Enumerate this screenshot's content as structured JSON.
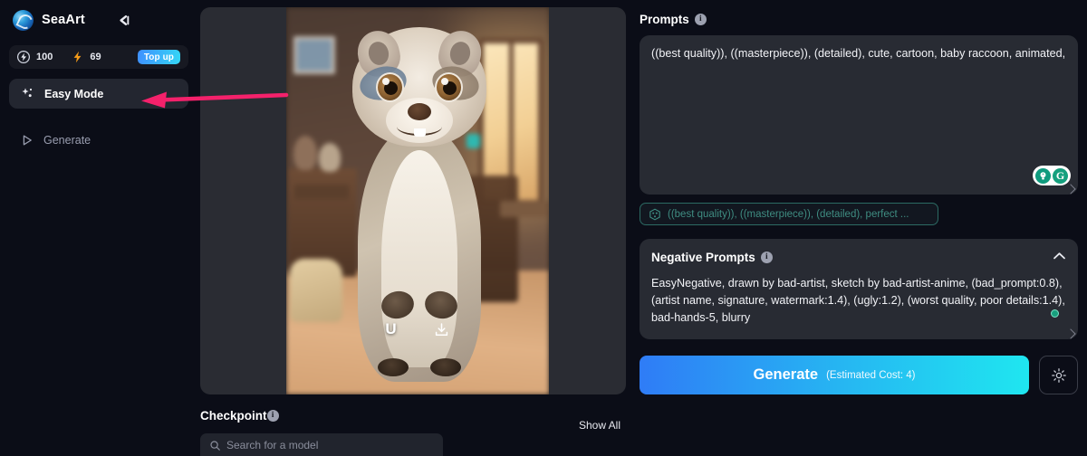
{
  "app": {
    "brand": "SeaArt",
    "collapse_icon": "collapse-sidebar-icon"
  },
  "sidebar": {
    "credits": {
      "diamond_icon": "credit-bolt-icon",
      "diamond_value": "100",
      "bolt_icon": "energy-bolt-icon",
      "bolt_value": "69",
      "topup_label": "Top up"
    },
    "items": [
      {
        "label": "Easy Mode",
        "icon": "sparkles-icon",
        "active": true
      },
      {
        "label": "Generate",
        "icon": "play-icon",
        "active": false
      }
    ]
  },
  "preview": {
    "upscale_label": "U",
    "download_icon": "download-icon",
    "image_alt": "cute cartoon baby raccoon standing in a warmly lit room"
  },
  "checkpoint": {
    "label": "Checkpoint",
    "show_all": "Show All",
    "search_placeholder": "Search for a model",
    "search_icon": "search-icon"
  },
  "prompts": {
    "title": "Prompts",
    "value": "((best quality)), ((masterpiece)), (detailed), cute, cartoon, baby raccoon, animated,",
    "bulb_icon": "lightbulb-icon",
    "grammar_icon": "grammarly-icon",
    "tag": {
      "icon": "dice-icon",
      "label": "((best quality)), ((masterpiece)), (detailed), perfect ..."
    }
  },
  "negative_prompts": {
    "title": "Negative Prompts",
    "collapse_icon": "chevron-up-icon",
    "value": "EasyNegative, drawn by bad-artist, sketch by bad-artist-anime, (bad_prompt:0.8), (artist name, signature, watermark:1.4), (ugly:1.2), (worst quality, poor details:1.4), bad-hands-5, blurry"
  },
  "generate": {
    "label": "Generate",
    "cost": "(Estimated Cost: 4)",
    "settings_icon": "gear-icon"
  },
  "annotation": {
    "arrow_color": "#f4216b",
    "points_to": "Easy Mode"
  },
  "colors": {
    "background": "#0b0d17",
    "panel": "#282b33",
    "accent": "#26b6f2",
    "teal": "#2fa58f"
  }
}
